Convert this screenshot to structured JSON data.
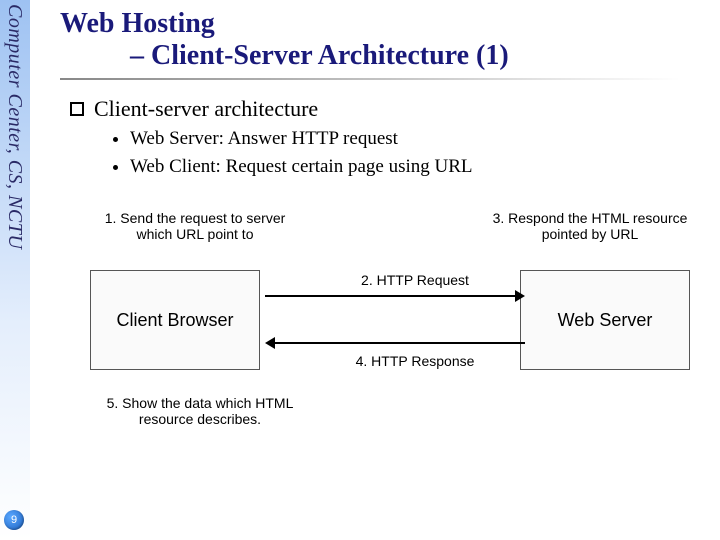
{
  "sidebar": {
    "org": "Computer Center, CS, NCTU"
  },
  "page": {
    "number": "9"
  },
  "title": {
    "line1": "Web Hosting",
    "line2": "– Client-Server Architecture (1)"
  },
  "bullets": {
    "main": "Client-server architecture",
    "sub": [
      "Web Server: Answer HTTP request",
      "Web Client: Request certain page using URL"
    ]
  },
  "diagram": {
    "step1": "1. Send the request to server which URL point to",
    "step3": "3. Respond the HTML resource pointed by URL",
    "client_box": "Client Browser",
    "server_box": "Web Server",
    "label_request": "2. HTTP Request",
    "label_response": "4. HTTP Response",
    "step5": "5. Show the data which HTML resource describes."
  }
}
